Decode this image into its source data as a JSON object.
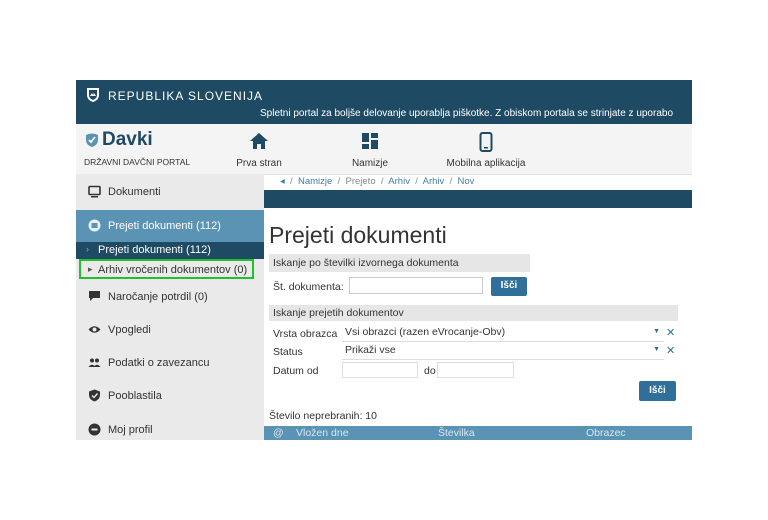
{
  "header": {
    "country": "REPUBLIKA SLOVENIJA",
    "cookie_notice": "Spletni portal za boljše delovanje uporablja piškotke. Z obiskom portala se strinjate z uporabo"
  },
  "brand": {
    "name": "Davki",
    "subtitle": "DRŽAVNI DAVČNI PORTAL"
  },
  "nav": [
    {
      "label": "Prva stran",
      "icon": "home-icon"
    },
    {
      "label": "Namizje",
      "icon": "dashboard-icon"
    },
    {
      "label": "Mobilna aplikacija",
      "icon": "mobile-icon"
    }
  ],
  "sidebar": {
    "items": [
      {
        "label": "Dokumenti",
        "icon": "monitor-icon"
      },
      {
        "label": "Prejeti dokumenti (112)",
        "icon": "inbox-icon"
      },
      {
        "label": "Naročanje potrdil (0)",
        "icon": "chat-icon"
      },
      {
        "label": "Vpogledi",
        "icon": "eye-icon"
      },
      {
        "label": "Podatki o zavezancu",
        "icon": "users-icon"
      },
      {
        "label": "Pooblastila",
        "icon": "shield-icon"
      },
      {
        "label": "Moj profil",
        "icon": "profile-icon"
      }
    ],
    "subitems": [
      {
        "label": "Prejeti dokumenti (112)"
      },
      {
        "label": "Arhiv vročenih dokumentov (0)"
      }
    ]
  },
  "breadcrumb": {
    "items": [
      "Namizje",
      "Prejeto",
      "Arhiv",
      "Arhiv",
      "Nov"
    ]
  },
  "main": {
    "title": "Prejeti dokumenti",
    "search_number": {
      "heading": "Iskanje po številki izvornega dokumenta",
      "label": "Št. dokumenta:",
      "value": "",
      "button": "Išči"
    },
    "search_received": {
      "heading": "Iskanje prejetih dokumentov",
      "form_type_label": "Vrsta obrazca",
      "form_type_value": "Vsi obrazci (razen eVrocanje-Obv)",
      "status_label": "Status",
      "status_value": "Prikaži vse",
      "date_from_label": "Datum od",
      "date_to_label": "do",
      "date_from_value": "",
      "date_to_value": "",
      "button": "Išči"
    },
    "unread": "Število neprebranih: 10",
    "table": {
      "columns": [
        "@",
        "Vložen dne",
        "Številka",
        "Obrazec"
      ]
    }
  },
  "colors": {
    "header_bg": "#1f4a63",
    "accent": "#5a93b4",
    "button": "#2f6f99",
    "highlight": "#22c02a"
  }
}
